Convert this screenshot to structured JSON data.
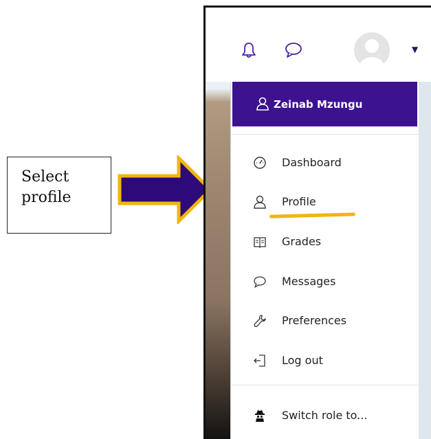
{
  "annotation": {
    "text": "Select profile",
    "arrow_fill": "#2d0a77",
    "arrow_outline": "#f2b50f"
  },
  "navbar": {
    "icons": [
      "bell-icon",
      "chat-icon",
      "avatar",
      "caret-down-icon"
    ]
  },
  "user_menu": {
    "user_name": "Zeinab Mzungu",
    "header_color": "#3d1290",
    "items": [
      {
        "label": "Dashboard",
        "icon": "gauge-icon"
      },
      {
        "label": "Profile",
        "icon": "user-icon"
      },
      {
        "label": "Grades",
        "icon": "book-icon"
      },
      {
        "label": "Messages",
        "icon": "chat-icon"
      },
      {
        "label": "Preferences",
        "icon": "wrench-icon"
      },
      {
        "label": "Log out",
        "icon": "logout-icon"
      }
    ],
    "switch_role_label": "Switch role to...",
    "highlight_color": "#f2b50f"
  }
}
